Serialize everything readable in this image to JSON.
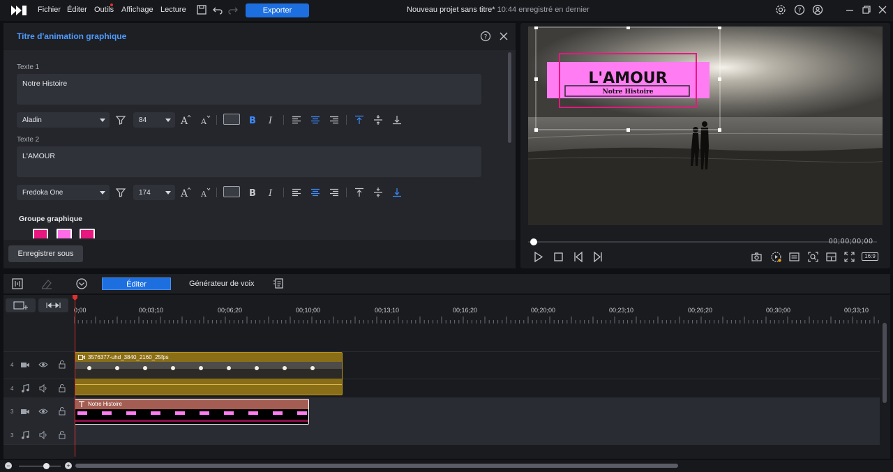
{
  "titlebar": {
    "menus": [
      "Fichier",
      "Éditer",
      "Outils",
      "Affichage",
      "Lecture"
    ],
    "export_label": "Exporter",
    "project_title": "Nouveau projet sans titre*",
    "project_status": "10:44 enregistré en dernier"
  },
  "panel": {
    "title": "Titre d'animation graphique",
    "text1_label": "Texte 1",
    "text1_value": "Notre Histoire",
    "font1": "Aladin",
    "size1": "84",
    "text2_label": "Texte 2",
    "text2_value": "L'AMOUR",
    "font2": "Fredoka One",
    "size2": "174",
    "group_label": "Groupe graphique",
    "swatches": [
      "#e8177f",
      "#ff6ce6",
      "#e8177f"
    ],
    "save_as": "Enregistrer sous"
  },
  "preview": {
    "overlay_title": "L'AMOUR",
    "overlay_subtitle": "Notre Histoire",
    "timecode": "00;00;00;00",
    "aspect": "16:9"
  },
  "timeline": {
    "edit_tab": "Éditer",
    "voice_tab": "Générateur de voix",
    "ruler": [
      "0;00",
      "00;03;10",
      "00;06;20",
      "00;10;00",
      "00;13;10",
      "00;16;20",
      "00;20;00",
      "00;23;10",
      "00;26;20",
      "00;30;00",
      "00;33;10"
    ],
    "tracks": [
      {
        "num": "4",
        "type": "video"
      },
      {
        "num": "4",
        "type": "audio"
      },
      {
        "num": "3",
        "type": "video"
      },
      {
        "num": "3",
        "type": "audio"
      }
    ],
    "video_clip": "3576377-uhd_3840_2160_25fps",
    "title_clip": "Notre Histoire"
  }
}
